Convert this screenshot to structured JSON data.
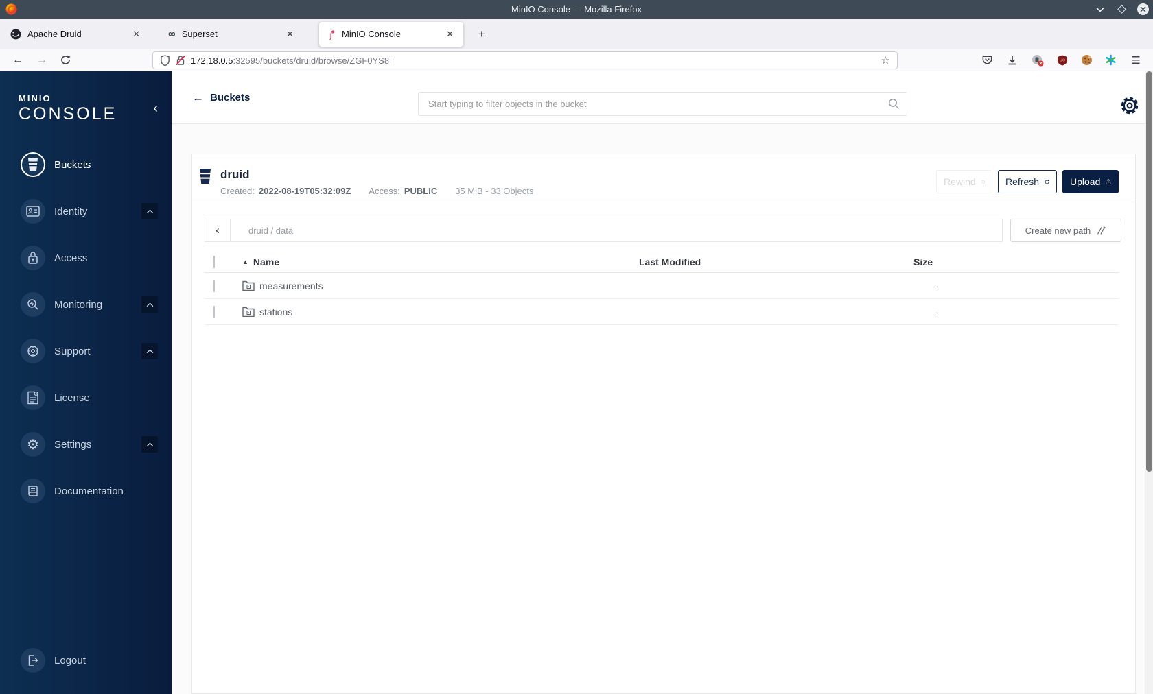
{
  "titlebar": {
    "title": "MinIO Console — Mozilla Firefox"
  },
  "tabs": [
    {
      "label": "Apache Druid"
    },
    {
      "label": "Superset"
    },
    {
      "label": "MinIO Console"
    }
  ],
  "urlbar": {
    "host": "172.18.0.5",
    "rest": ":32595/buckets/druid/browse/ZGF0YS8="
  },
  "icons": {
    "back_nav": "←",
    "forward_nav": "→",
    "star": "☆",
    "new_tab": "+",
    "hamburger": "☰",
    "close_tab": "✕",
    "collapse": "‹",
    "path_back": "‹",
    "infinity": "∞",
    "sort_asc": "▲",
    "settings_glyph": "⚙",
    "back_link": "←",
    "window_close": "✕"
  },
  "sidebar": {
    "logo_top": "MINIO",
    "logo_bottom": "CONSOLE",
    "items": [
      {
        "label": "Buckets",
        "icon": "bucket-icon",
        "active": true
      },
      {
        "label": "Identity",
        "icon": "identity-icon",
        "expandable": true
      },
      {
        "label": "Access",
        "icon": "access-icon"
      },
      {
        "label": "Monitoring",
        "icon": "monitoring-icon",
        "expandable": true
      },
      {
        "label": "Support",
        "icon": "support-icon",
        "expandable": true
      },
      {
        "label": "License",
        "icon": "license-icon"
      },
      {
        "label": "Settings",
        "icon": "settings-icon",
        "expandable": true
      },
      {
        "label": "Documentation",
        "icon": "documentation-icon"
      }
    ],
    "logout": "Logout"
  },
  "header": {
    "back": "Buckets",
    "search_placeholder": "Start typing to filter objects in the bucket"
  },
  "bucket": {
    "name": "druid",
    "created_label": "Created:",
    "created_value": "2022-08-19T05:32:09Z",
    "access_label": "Access:",
    "access_value": "PUBLIC",
    "stats": "35 MiB - 33 Objects",
    "rewind": "Rewind",
    "refresh": "Refresh",
    "upload": "Upload"
  },
  "pathbar": {
    "breadcrumb": "druid / data",
    "create": "Create new path"
  },
  "objects": {
    "headers": {
      "name": "Name",
      "modified": "Last Modified",
      "size": "Size"
    },
    "rows": [
      {
        "name": "measurements",
        "size": "-"
      },
      {
        "name": "stations",
        "size": "-"
      }
    ]
  },
  "colors": {
    "accent_navy": "#0a1f44",
    "flamingo_red": "#cd3c5f",
    "sidebar_start": "#0d2f52",
    "sidebar_end": "#091c3e"
  }
}
